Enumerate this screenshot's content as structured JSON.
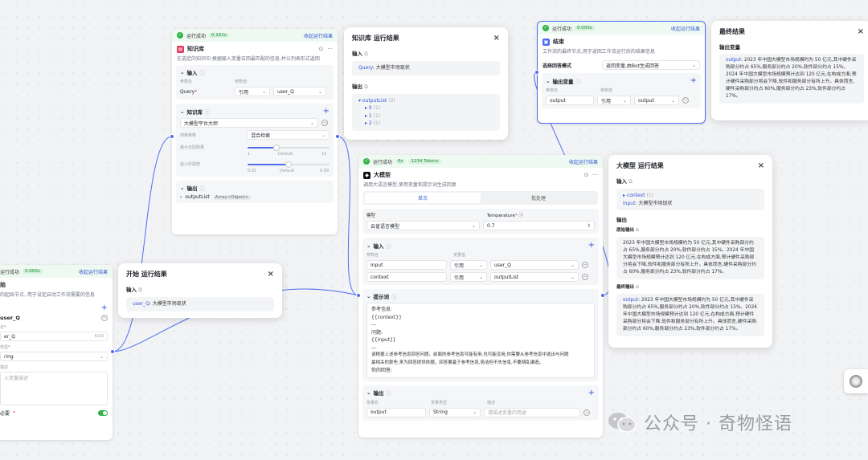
{
  "status": {
    "success": "运行成功",
    "view_result": "收起运行结果",
    "kb_time": "0.161s",
    "start_time": "0.000s",
    "end_time": "0.000s",
    "llm_time": "6s",
    "llm_tokens": "1234 Tokens"
  },
  "kb_node": {
    "title": "知识库",
    "desc": "在选定的知识中,根据输入变量召回最匹配的信息,并以列表形式返回",
    "input_label": "输入",
    "param_name": "参数名",
    "param_value": "参数值",
    "query_label": "Query",
    "ref": "引用",
    "var": "user_Q",
    "kb_label": "知识库",
    "kb_name": "大模型平台大师",
    "search_strategy": "搜索策略",
    "search_value": "混合检索",
    "max_recall": "最大召回数量",
    "max_min": "1",
    "max_default": "Default",
    "max_max": "10",
    "min_match": "最小匹配度",
    "min_min": "0.01",
    "min_default": "Default",
    "min_max": "0.99",
    "max_recall_value": 0.35,
    "min_match_value": 0.5,
    "output_label": "输出",
    "output_var": "outputList",
    "output_type": "Array<Object>"
  },
  "kb_panel": {
    "title": "知识库 运行结果",
    "input": "输入",
    "query": "Query",
    "query_val": ": 大模型市场现状",
    "output": "输出",
    "list": "outputList",
    "list_count": "(3)",
    "items": [
      "0",
      "1",
      "2"
    ],
    "item_counts": [
      "(1)",
      "(1)",
      "(1)"
    ]
  },
  "start_node": {
    "title": "始",
    "desc": "的起始节点, 用于设定启动工作流需要的信息",
    "var": "user_Q",
    "name_label": "名",
    "name_val": "er_Q",
    "count": "6/20",
    "type_label": "类型",
    "type_val": "ring",
    "desc_label": "描述",
    "desc_ph": "入变量描述",
    "required": "必要"
  },
  "start_panel": {
    "title": "开始 运行结果",
    "input": "输入",
    "var": "user_Q",
    "val": ": 大模型市场现状"
  },
  "llm_node": {
    "title": "大模型",
    "desc": "调用大语言模型,使用变量和提示词生成回复",
    "tab_single": "单次",
    "tab_batch": "批处理",
    "model_label": "模型",
    "model_val": "云雀语言模型",
    "temp_label": "Temperature",
    "temp_val": "0.7",
    "input_label": "输入",
    "param_name": "参数名",
    "var_value": "变量值",
    "rows": [
      {
        "name": "input",
        "ref": "引用",
        "var": "user_Q"
      },
      {
        "name": "context",
        "ref": "引用",
        "var": "outputList"
      }
    ],
    "prompt_label": "提示词",
    "prompt_lines": [
      "参考信息:",
      "{{context}}",
      "---",
      "问题:",
      "{{input}}",
      "---",
      "请根据上述参考信息回答问题。前面的参考信息可能有用,也可能没用,你需要从参考信息中选出与问题",
      "最相关的那些,来为回答提供依据。回答要基于参考信息,简洁但不失信息,不要胡乱编造。",
      "你的回答:"
    ],
    "output_label": "输出",
    "out_name": "变量名",
    "out_type": "变量类型",
    "out_desc": "描述",
    "out_var": "output",
    "out_type_val": "String",
    "out_ph": "请描述变量的用途"
  },
  "llm_panel": {
    "title": "大模型 运行结果",
    "input": "输入",
    "context": "context",
    "context_count": "(1)",
    "input_var": "input",
    "input_val": ": 大模型市场现状",
    "output": "输出",
    "raw": "原始输出",
    "raw_text": "2023 年中国大模型市场规模约为 50 亿元,其中硬件采购部分约占 65%,服务部分约占 20%,软件部分约占 15%。2024 年中国大模型市场规模预计达到 120 亿元,在构成方面,预计硬件采购部分将会下降,软件和服务部分有所上升。具体而言,硬件采购部分约占 60%,服务部分约占 23%,软件部分约占 17%。",
    "final": "最终输出",
    "final_var": "output",
    "final_text": ": 2023 年中国大模型市场规模约为 50 亿元,其中硬件采购部分约占 65%,服务部分约占 20%,软件部分约占 15%。2024 年中国大模型市场规模预计达到 120 亿元,在构成方面,预计硬件采购部分将会下降,软件和服务部分有所上升。具体而言,硬件采购部分约占 60%,服务部分约占 23%,软件部分约占 17%。"
  },
  "end_node": {
    "title": "结束",
    "desc": "工作流的最终节点,用于返回工作流运行后的结果信息",
    "mode_label": "选择回答模式",
    "mode_val": "返回变量,由Bot生成回答",
    "out_label": "输出变量",
    "param_name": "参数名",
    "param_value": "参数值",
    "var": "output",
    "ref": "引用",
    "ref_var": "output"
  },
  "end_panel": {
    "title": "最终结果",
    "out_label": "输出变量",
    "var": "output",
    "text": ": 2023 年中国大模型市场规模约为 50 亿元,其中硬件采购部分约占 65%,服务部分约占 20%,软件部分约占 15%。2024 年中国大模型市场规模预计达到 120 亿元,在构成方面,预计硬件采购部分将会下降,软件和服务部分有所上升。具体而言,硬件采购部分约占 60%,服务部分约占 23%,软件部分约占 17%。"
  },
  "watermark": "公众号 · 奇物怪语",
  "colors": {
    "accent": "#4e6ef2",
    "success": "#2fb34a",
    "kb": "#e0355d",
    "llm": "#111111",
    "end": "#4e6ef2"
  }
}
